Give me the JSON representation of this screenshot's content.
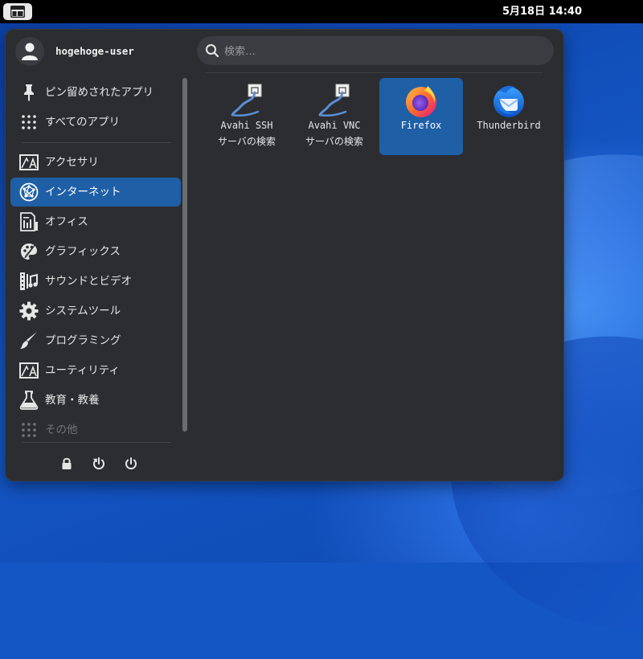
{
  "topbar": {
    "clock": "5月18日 14:40"
  },
  "user": {
    "name": "hogehoge-user"
  },
  "search": {
    "placeholder": "検索…"
  },
  "categories": [
    {
      "label": "ピン留めされたアプリ",
      "icon": "pin-icon"
    },
    {
      "label": "すべてのアプリ",
      "icon": "grid-icon"
    },
    {
      "label": "アクセサリ",
      "icon": "accessories-icon"
    },
    {
      "label": "インターネット",
      "icon": "internet-icon",
      "active": true
    },
    {
      "label": "オフィス",
      "icon": "office-icon"
    },
    {
      "label": "グラフィックス",
      "icon": "graphics-icon"
    },
    {
      "label": "サウンドとビデオ",
      "icon": "multimedia-icon"
    },
    {
      "label": "システムツール",
      "icon": "gear-icon"
    },
    {
      "label": "プログラミング",
      "icon": "brush-icon"
    },
    {
      "label": "ユーティリティ",
      "icon": "utilities-icon"
    },
    {
      "label": "教育・教養",
      "icon": "flask-icon"
    },
    {
      "label": "その他",
      "icon": "grid-icon",
      "dimmed": true
    }
  ],
  "apps": [
    {
      "name": "Avahi SSH",
      "subtitle": "サーバの検索",
      "icon": "network-browser-icon"
    },
    {
      "name": "Avahi VNC",
      "subtitle": "サーバの検索",
      "icon": "network-browser-icon"
    },
    {
      "name": "Firefox",
      "icon": "firefox-icon",
      "selected": true
    },
    {
      "name": "Thunderbird",
      "icon": "thunderbird-icon"
    }
  ],
  "bottom_actions": [
    "lock-icon",
    "restart-icon",
    "power-icon"
  ],
  "colors": {
    "accent": "#1f5fa6",
    "menu_bg": "#2c2d31",
    "topbar": "#000000"
  }
}
